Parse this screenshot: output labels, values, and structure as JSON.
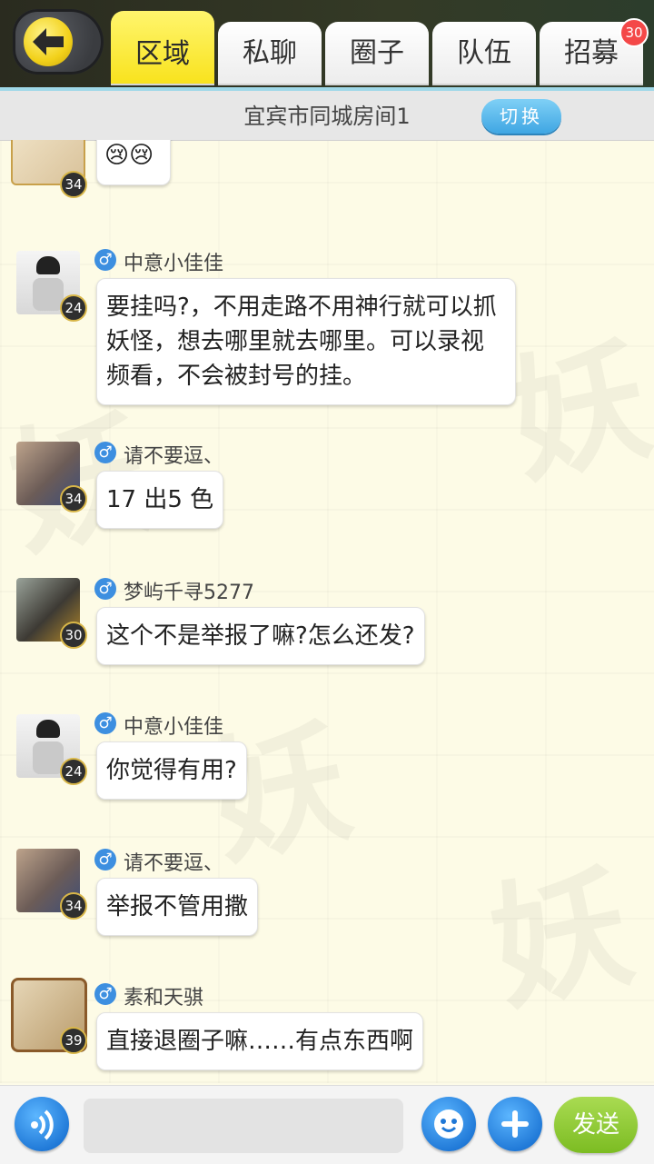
{
  "header": {
    "tabs": [
      {
        "label": "区域"
      },
      {
        "label": "私聊"
      },
      {
        "label": "圈子"
      },
      {
        "label": "队伍"
      },
      {
        "label": "招募"
      }
    ],
    "recruit_badge": "30"
  },
  "room": {
    "title": "宜宾市同城房间1",
    "switch_label": "切换"
  },
  "messages": [
    {
      "name": "",
      "level": "34",
      "text": "😢😢"
    },
    {
      "name": "中意小佳佳",
      "level": "24",
      "text": "要挂吗?，不用走路不用神行就可以抓妖怪，想去哪里就去哪里。可以录视频看，不会被封号的挂。"
    },
    {
      "name": "请不要逗、",
      "level": "34",
      "text": "17 出5 色"
    },
    {
      "name": "梦屿千寻5277",
      "level": "30",
      "text": "这个不是举报了嘛?怎么还发?"
    },
    {
      "name": "中意小佳佳",
      "level": "24",
      "text": "你觉得有用?"
    },
    {
      "name": "请不要逗、",
      "level": "34",
      "text": "举报不管用撒"
    },
    {
      "name": "素和天骐",
      "level": "39",
      "text": "直接退圈子嘛……有点东西啊"
    }
  ],
  "composer": {
    "send_label": "发送",
    "placeholder": ""
  },
  "colors": {
    "active_tab": "#f8e21c",
    "accent_blue": "#2a86e0",
    "send_green": "#86c62c"
  }
}
